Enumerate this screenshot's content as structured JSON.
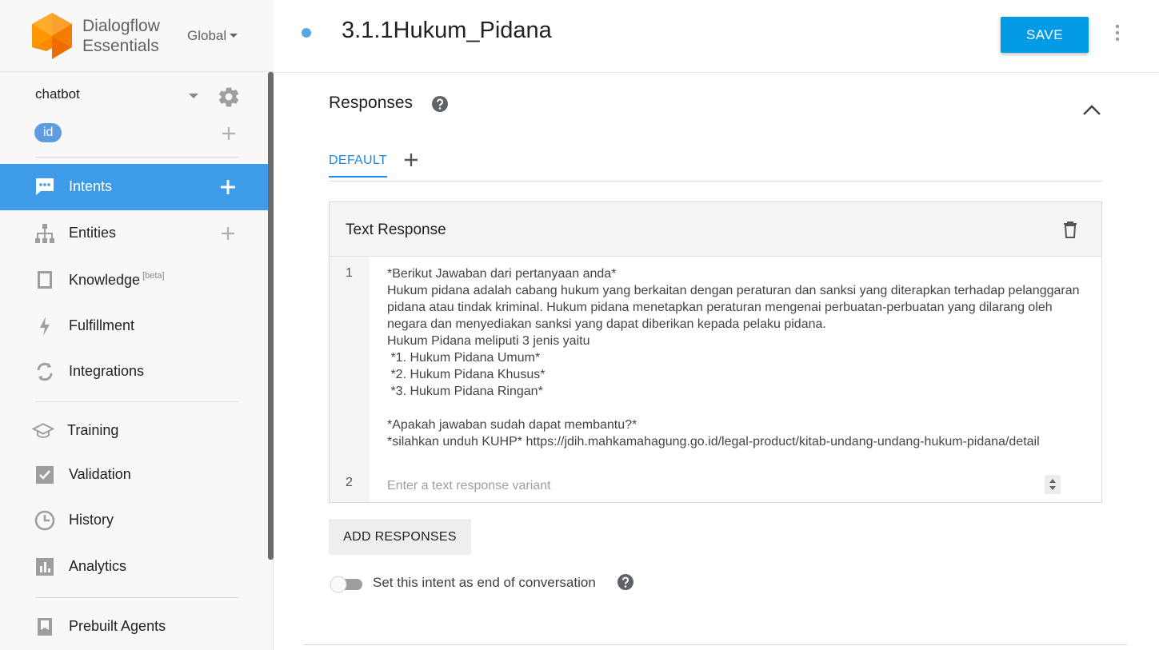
{
  "brand": {
    "name_line1": "Dialogflow",
    "name_line2": "Essentials",
    "region": "Global",
    "logo_color": "#ff9800"
  },
  "agent": {
    "name": "chatbot",
    "language": "id"
  },
  "nav": {
    "items": [
      {
        "label": "Intents",
        "icon": "chat-icon",
        "active": true
      },
      {
        "label": "Entities",
        "icon": "hierarchy-icon"
      },
      {
        "label": "Knowledge",
        "badge": "[beta]",
        "icon": "book-icon"
      },
      {
        "label": "Fulfillment",
        "icon": "bolt-icon"
      },
      {
        "label": "Integrations",
        "icon": "sync-icon"
      },
      {
        "label": "Training",
        "icon": "graduation-cap-icon"
      },
      {
        "label": "Validation",
        "icon": "checkbox-icon"
      },
      {
        "label": "History",
        "icon": "clock-icon"
      },
      {
        "label": "Analytics",
        "icon": "bar-chart-icon"
      },
      {
        "label": "Prebuilt Agents",
        "icon": "agent-book-icon"
      }
    ]
  },
  "header": {
    "intent_name": "3.1.1Hukum_Pidana",
    "save_label": "SAVE",
    "accent": "#039be5"
  },
  "responses": {
    "title": "Responses",
    "tabs": [
      {
        "label": "DEFAULT",
        "active": true
      }
    ],
    "card_title": "Text Response",
    "rows": [
      {
        "number": "1",
        "text": "*Berikut Jawaban dari pertanyaan anda*\nHukum pidana adalah cabang hukum yang berkaitan dengan peraturan dan sanksi yang diterapkan terhadap pelanggaran pidana atau tindak kriminal. Hukum pidana menetapkan peraturan mengenai perbuatan-perbuatan yang dilarang oleh negara dan menyediakan sanksi yang dapat diberikan kepada pelaku pidana.\nHukum Pidana meliputi 3 jenis yaitu\n *1. Hukum Pidana Umum*\n *2. Hukum Pidana Khusus*\n *3. Hukum Pidana Ringan*\n\n*Apakah jawaban sudah dapat membantu?*\n*silahkan unduh KUHP* https://jdih.mahkamahagung.go.id/legal-product/kitab-undang-undang-hukum-pidana/detail"
      },
      {
        "number": "2",
        "placeholder": "Enter a text response variant"
      }
    ],
    "add_label": "ADD RESPONSES",
    "end_conversation_label": "Set this intent as end of conversation",
    "end_conversation_on": false
  }
}
